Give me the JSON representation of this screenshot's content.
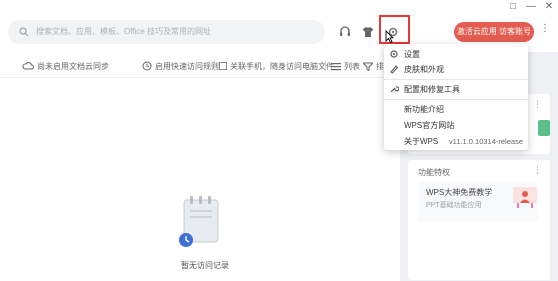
{
  "window": {
    "restore_glyph": "□",
    "minimize_glyph": "—",
    "close_glyph": "✕"
  },
  "header": {
    "search_placeholder": "搜索文档、应用、模板、Office 技巧及常用的网址",
    "cta_label": "激活云应用 访客账号",
    "more_glyph": "⋮",
    "icons": [
      "headset-icon",
      "skin-icon",
      "settings-icon"
    ]
  },
  "toolbar": {
    "sync_label": "尚未启用文档云同步",
    "quick_access_label": "启用快速访问规则",
    "phone_link_label": "关联手机，随身访问电脑文件",
    "list_label": "列表",
    "sort_label": "排"
  },
  "main": {
    "empty_text": "暂无访问记录"
  },
  "right_panel": {
    "card1_more": "⋮",
    "card2_title": "功能特权",
    "card2_more": "⋮",
    "promo_title": "WPS大神免费教学",
    "promo_sub": "PPT基础功能应用"
  },
  "dropdown": {
    "items": [
      {
        "label": "设置",
        "icon": "gear-icon"
      },
      {
        "label": "皮肤和外观",
        "icon": "brush-icon"
      },
      {
        "label": "配置和修复工具",
        "icon": "wrench-icon"
      },
      {
        "label": "新功能介绍",
        "icon": ""
      },
      {
        "label": "WPS官方网站",
        "icon": ""
      },
      {
        "label": "关于WPS",
        "icon": ""
      }
    ],
    "version": "v11.1.0.10314-release"
  },
  "colors": {
    "accent": "#e35c4f",
    "highlight_border": "#e53935",
    "panel_bg": "#eef0f3"
  }
}
